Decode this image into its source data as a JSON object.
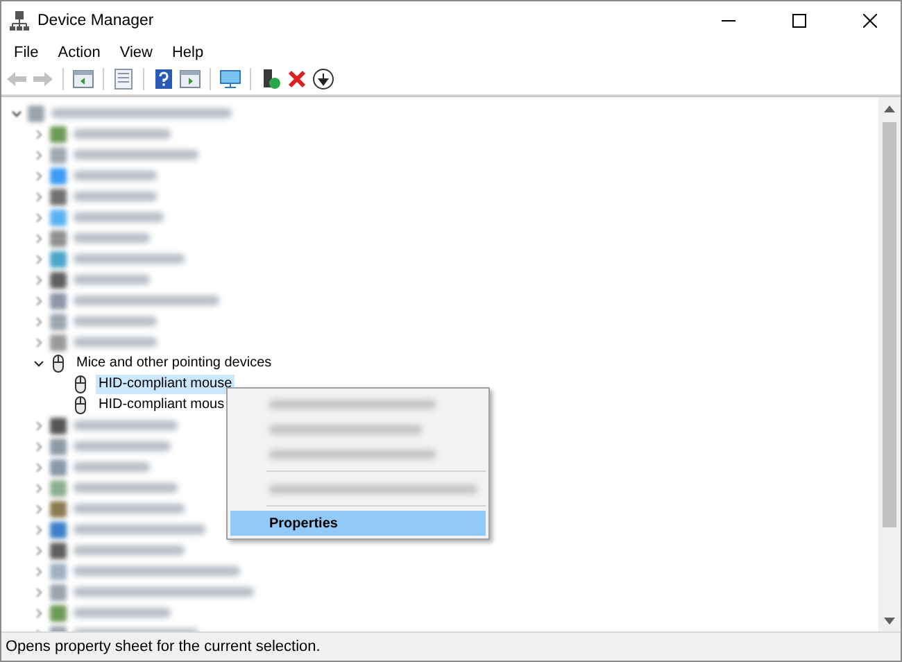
{
  "window": {
    "title": "Device Manager"
  },
  "menu_bar": [
    {
      "label": "File"
    },
    {
      "label": "Action"
    },
    {
      "label": "View"
    },
    {
      "label": "Help"
    }
  ],
  "toolbar": [
    {
      "kind": "back",
      "disabled": true
    },
    {
      "kind": "forward",
      "disabled": true
    },
    {
      "kind": "separator"
    },
    {
      "kind": "panel",
      "disabled": false
    },
    {
      "kind": "separator"
    },
    {
      "kind": "sheet",
      "disabled": false
    },
    {
      "kind": "separator"
    },
    {
      "kind": "help",
      "disabled": false
    },
    {
      "kind": "panel2",
      "disabled": false
    },
    {
      "kind": "separator"
    },
    {
      "kind": "monitor",
      "disabled": false
    },
    {
      "kind": "separator"
    },
    {
      "kind": "add",
      "disabled": false
    },
    {
      "kind": "remove",
      "disabled": false
    },
    {
      "kind": "download",
      "disabled": false
    }
  ],
  "tree": {
    "kind": "blurred",
    "expanded": true,
    "children": [
      {
        "kind": "blurred",
        "expanded": false
      },
      {
        "kind": "blurred",
        "expanded": false
      },
      {
        "kind": "blurred",
        "expanded": false
      },
      {
        "kind": "blurred",
        "expanded": false
      },
      {
        "kind": "blurred",
        "expanded": false
      },
      {
        "kind": "blurred",
        "expanded": false
      },
      {
        "kind": "blurred",
        "expanded": false
      },
      {
        "kind": "blurred",
        "expanded": false
      },
      {
        "kind": "blurred",
        "expanded": false
      },
      {
        "kind": "blurred",
        "expanded": false
      },
      {
        "kind": "blurred",
        "expanded": false
      },
      {
        "kind": "category",
        "label": "Mice and other pointing devices",
        "expanded": true,
        "children": [
          {
            "kind": "device",
            "label": "HID-compliant mouse",
            "selected": true
          },
          {
            "kind": "device",
            "label": "HID-compliant mous",
            "selected": false
          }
        ]
      },
      {
        "kind": "blurred",
        "expanded": false
      },
      {
        "kind": "blurred",
        "expanded": false
      },
      {
        "kind": "blurred",
        "expanded": false
      },
      {
        "kind": "blurred",
        "expanded": false
      },
      {
        "kind": "blurred",
        "expanded": false
      },
      {
        "kind": "blurred",
        "expanded": false
      },
      {
        "kind": "blurred",
        "expanded": false
      },
      {
        "kind": "blurred",
        "expanded": false
      },
      {
        "kind": "blurred",
        "expanded": false
      },
      {
        "kind": "blurred",
        "expanded": false
      },
      {
        "kind": "blurred",
        "expanded": false
      }
    ]
  },
  "context_menu": [
    {
      "kind": "blurred",
      "selected": false
    },
    {
      "kind": "blurred",
      "selected": false
    },
    {
      "kind": "blurred",
      "selected": false
    },
    {
      "kind": "separator"
    },
    {
      "kind": "blurred",
      "selected": false
    },
    {
      "kind": "separator"
    },
    {
      "kind": "item",
      "label": "Properties",
      "selected": true
    }
  ],
  "status_bar": {
    "text": "Opens property sheet for the current selection."
  }
}
